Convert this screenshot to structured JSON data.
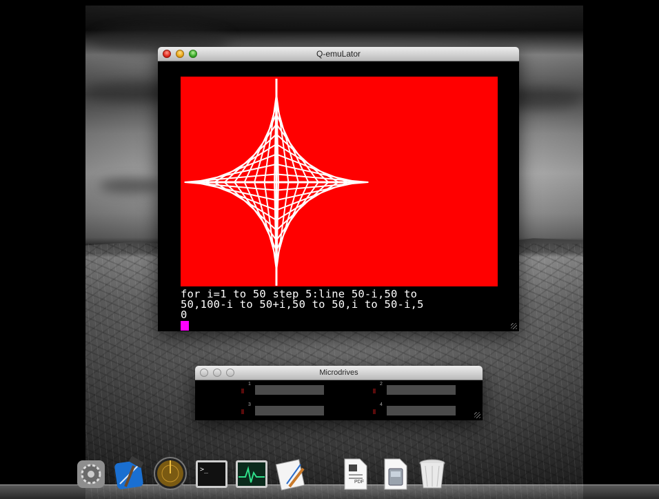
{
  "qemu_window": {
    "title": "Q-emuLator",
    "screen_color": "#ff0000",
    "basic_lines": [
      "for i=1 to 50 step 5:line 50-i,50 to",
      "50,100-i to 50+i,50 to 50,i to 50-i,5",
      "0"
    ],
    "cursor_color": "#ff00ff"
  },
  "microdrives_window": {
    "title": "Microdrives",
    "drives": [
      {
        "label": "1"
      },
      {
        "label": "2"
      },
      {
        "label": "3"
      },
      {
        "label": "4"
      }
    ]
  },
  "dock": {
    "items": [
      {
        "icon": "system-preferences-icon"
      },
      {
        "icon": "xcode-icon"
      },
      {
        "icon": "network-radar-icon"
      },
      {
        "icon": "terminal-icon"
      },
      {
        "icon": "activity-monitor-icon"
      },
      {
        "icon": "script-editor-icon"
      },
      {
        "icon": "pdf-document-icon",
        "badge": "PDF"
      },
      {
        "icon": "disk-image-icon"
      },
      {
        "icon": "trash-icon"
      }
    ]
  }
}
